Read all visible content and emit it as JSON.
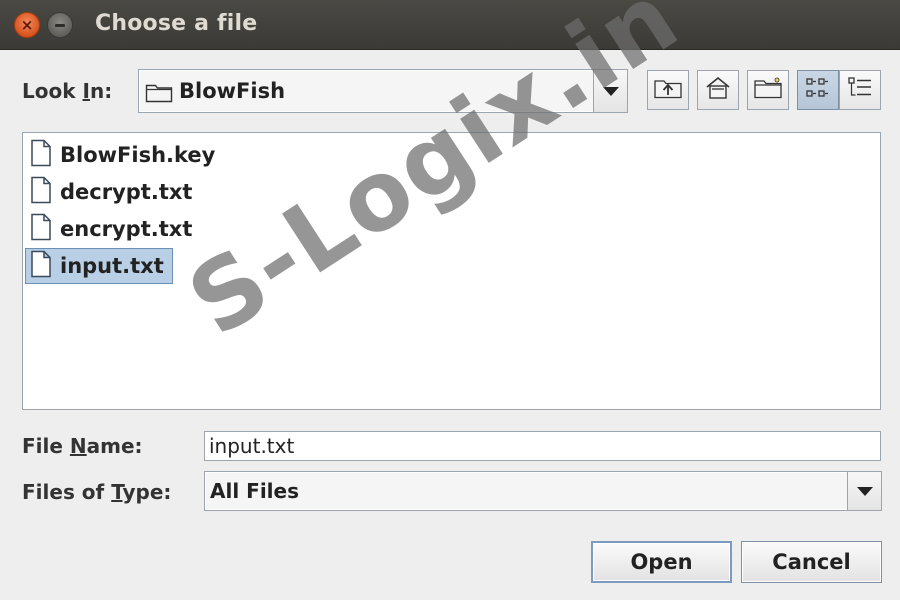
{
  "window": {
    "title": "Choose a file",
    "close_glyph": "×"
  },
  "look_in": {
    "label_pre": "Look ",
    "label_mnemonic": "I",
    "label_post": "n:",
    "value": "BlowFish"
  },
  "toolbar": {
    "buttons": [
      {
        "name": "up-one-level-icon"
      },
      {
        "name": "home-icon"
      },
      {
        "name": "new-folder-icon"
      },
      {
        "name": "list-view-icon",
        "pressed": true
      },
      {
        "name": "details-view-icon"
      }
    ]
  },
  "files": [
    {
      "name": "BlowFish.key"
    },
    {
      "name": "decrypt.txt"
    },
    {
      "name": "encrypt.txt"
    },
    {
      "name": "input.txt",
      "selected": true
    }
  ],
  "file_name": {
    "label_pre": "File ",
    "label_mnemonic": "N",
    "label_post": "ame:",
    "value": "input.txt"
  },
  "files_of_type": {
    "label_pre": "Files of ",
    "label_mnemonic": "T",
    "label_post": "ype:",
    "value": "All Files"
  },
  "buttons": {
    "open": "Open",
    "cancel": "Cancel"
  },
  "watermark": "S-Logix.in",
  "colors": {
    "titlebar": "#3b3a36",
    "close_button": "#e05a23",
    "selection": "#b8cfe5",
    "background": "#eeeeee"
  }
}
